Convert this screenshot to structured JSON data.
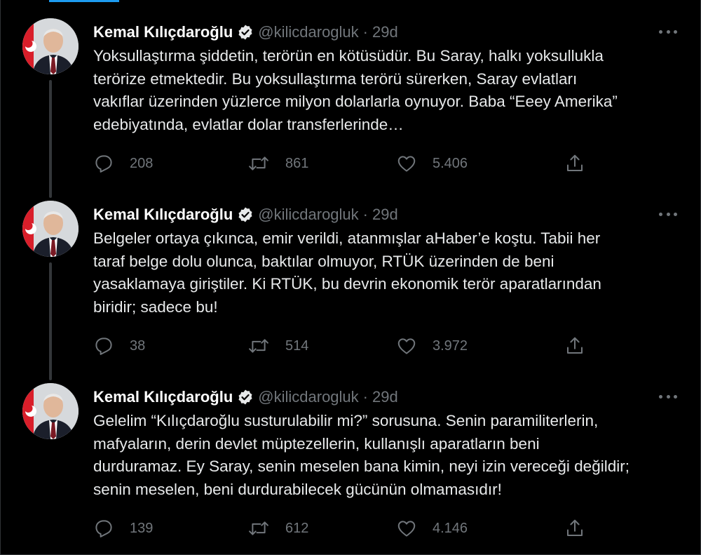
{
  "colors": {
    "background": "#000000",
    "text": "#e7e9ea",
    "muted": "#71767b",
    "verified_badge": "#e7e9ea",
    "accent": "#1d9bf0"
  },
  "icons": {
    "verified": "verified-badge-icon",
    "more": "more-options-icon",
    "reply": "reply-icon",
    "retweet": "retweet-icon",
    "like": "heart-icon",
    "share": "share-icon"
  },
  "tweets": [
    {
      "author": "Kemal Kılıçdaroğlu",
      "handle": "@kilicdarogluk",
      "separator": "·",
      "time": "29d",
      "lines": [
        "Yoksullaştırma şiddetin, terörün en kötüsüdür. Bu Saray, halkı yoksullukla",
        "terörize etmektedir. Bu yoksullaştırma terörü sürerken, Saray evlatları",
        "vakıflar üzerinden yüzlerce milyon dolarlarla oynuyor. Baba “Eeey Amerika”",
        "edebiyatında, evlatlar dolar transferlerinde…"
      ],
      "replies": "208",
      "retweets": "861",
      "likes": "5.406"
    },
    {
      "author": "Kemal Kılıçdaroğlu",
      "handle": "@kilicdarogluk",
      "separator": "·",
      "time": "29d",
      "lines": [
        "Belgeler ortaya çıkınca, emir verildi, atanmışlar aHaber’e koştu. Tabii her",
        "taraf belge dolu olunca, baktılar olmuyor, RTÜK üzerinden de beni",
        "yasaklamaya giriştiler. Ki RTÜK, bu devrin ekonomik terör aparatlarından",
        "biridir; sadece bu!"
      ],
      "replies": "38",
      "retweets": "514",
      "likes": "3.972"
    },
    {
      "author": "Kemal Kılıçdaroğlu",
      "handle": "@kilicdarogluk",
      "separator": "·",
      "time": "29d",
      "lines": [
        "Gelelim “Kılıçdaroğlu susturulabilir mi?” sorusuna. Senin paramiliterlerin,",
        "mafyaların, derin devlet müptezellerin, kullanışlı aparatların beni",
        "durduramaz. Ey Saray, senin meselen bana kimin, neyi izin vereceği değildir;",
        "senin meselen, beni durdurabilecek gücünün olmamasıdır!"
      ],
      "replies": "139",
      "retweets": "612",
      "likes": "4.146"
    }
  ]
}
